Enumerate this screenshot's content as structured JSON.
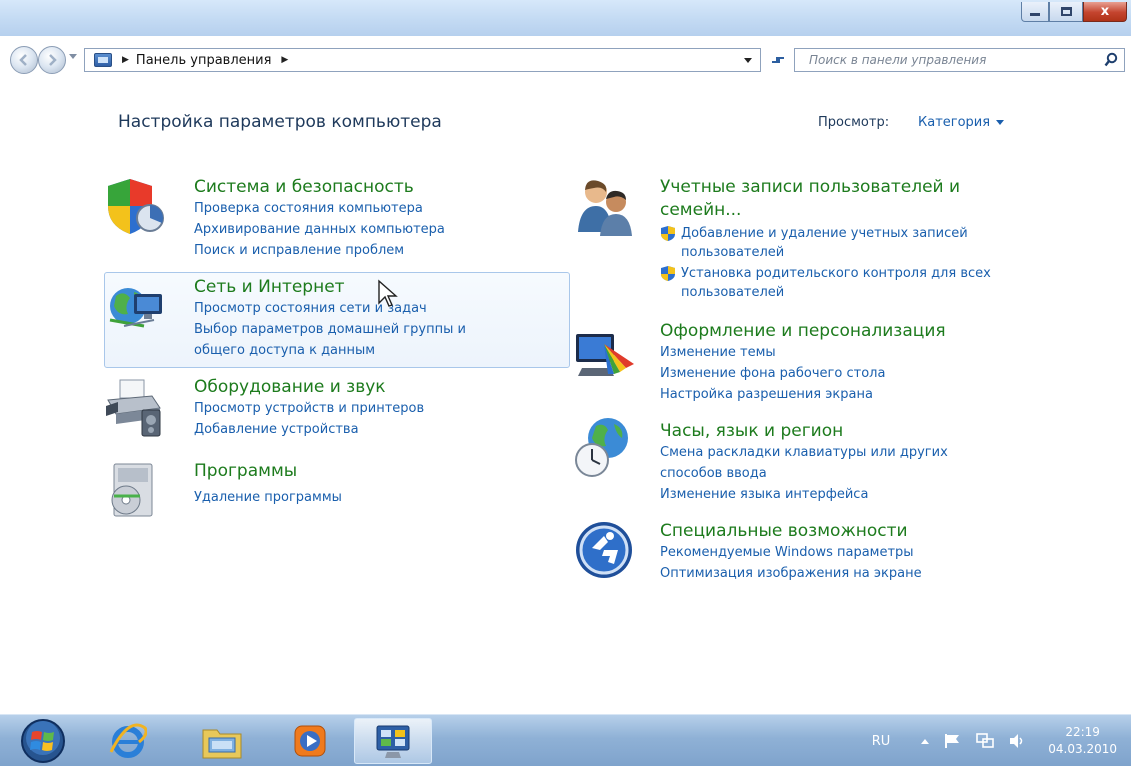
{
  "window": {
    "address": {
      "crumb": "Панель управления"
    },
    "search": {
      "placeholder": "Поиск в панели управления"
    },
    "caption_buttons": {
      "close_label": "x"
    }
  },
  "page": {
    "title": "Настройка параметров компьютера",
    "view_label": "Просмотр:",
    "view_value": "Категория"
  },
  "categories": {
    "system": {
      "title": "Система и безопасность",
      "links": [
        "Проверка состояния компьютера",
        "Архивирование данных компьютера",
        "Поиск и исправление проблем"
      ]
    },
    "network": {
      "title": "Сеть и Интернет",
      "links": [
        "Просмотр состояния сети и задач",
        "Выбор параметров домашней группы и",
        "общего доступа к данным"
      ]
    },
    "hardware": {
      "title": "Оборудование и звук",
      "links": [
        "Просмотр устройств и принтеров",
        "Добавление устройства"
      ]
    },
    "programs": {
      "title": "Программы",
      "links": [
        "Удаление программы"
      ]
    },
    "users": {
      "title": "Учетные записи пользователей и семейн...",
      "links": [
        "Добавление и удаление учетных записей пользователей",
        "Установка родительского контроля для всех пользователей"
      ]
    },
    "appearance": {
      "title": "Оформление и персонализация",
      "links": [
        "Изменение темы",
        "Изменение фона рабочего стола",
        "Настройка разрешения экрана"
      ]
    },
    "clock": {
      "title": "Часы, язык и регион",
      "links": [
        "Смена раскладки клавиатуры или других",
        "способов ввода",
        "Изменение языка интерфейса"
      ]
    },
    "access": {
      "title": "Специальные возможности",
      "links": [
        "Рекомендуемые Windows параметры",
        "Оптимизация изображения на экране"
      ]
    }
  },
  "taskbar": {
    "language": "RU",
    "time": "22:19",
    "date": "04.03.2010"
  },
  "colors": {
    "category_title": "#1d7b1d",
    "link": "#1a5fad",
    "heading": "#1e395b"
  },
  "icons": [
    "back-icon",
    "forward-icon",
    "control-panel-icon",
    "refresh-icon",
    "search-icon",
    "shield-icon",
    "users-icon",
    "network-icon",
    "printer-icon",
    "programs-icon",
    "appearance-icon",
    "globe-clock-icon",
    "accessibility-icon",
    "windows-orb-icon",
    "internet-explorer-icon",
    "explorer-folder-icon",
    "media-player-icon",
    "flag-icon",
    "network-tray-icon",
    "volume-icon"
  ]
}
